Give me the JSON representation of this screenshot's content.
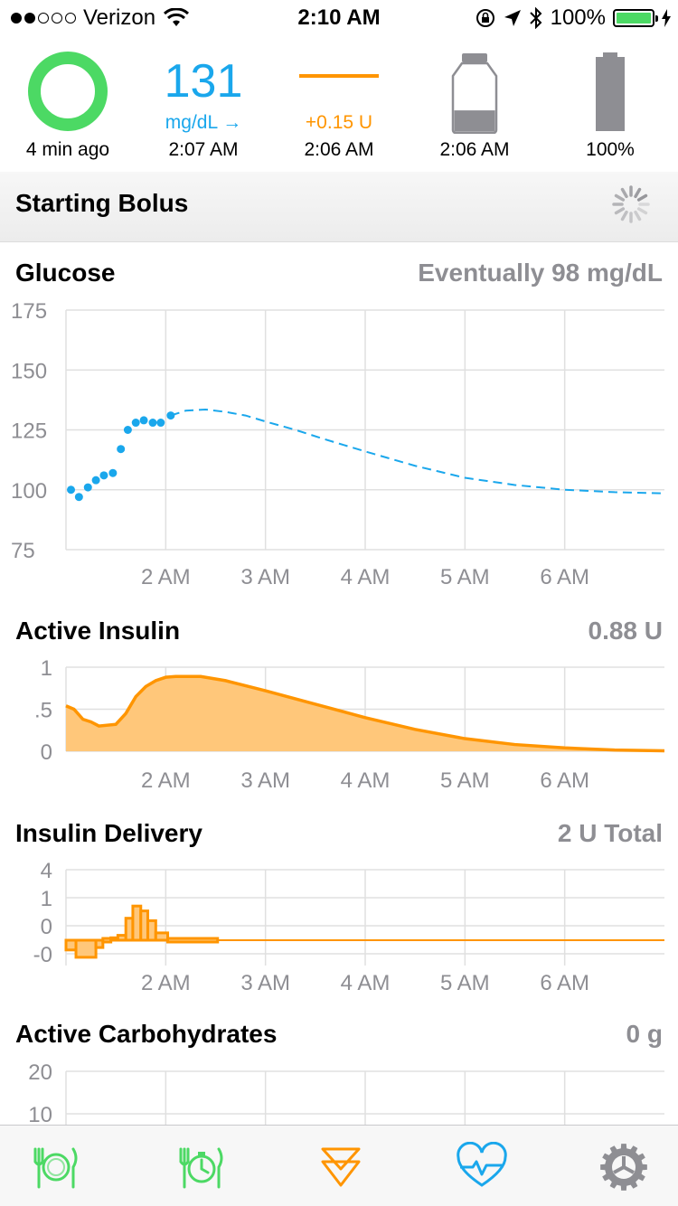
{
  "status_bar": {
    "carrier": "Verizon",
    "time": "2:10 AM",
    "battery_percent": "100%"
  },
  "hud": {
    "loop": {
      "age": "4 min ago"
    },
    "glucose": {
      "value": "131",
      "unit": "mg/dL →",
      "time": "2:07 AM"
    },
    "basal": {
      "rate": "+0.15 U",
      "time": "2:06 AM"
    },
    "reservoir": {
      "time": "2:06 AM",
      "level": 0.3
    },
    "pump_battery": {
      "percent": "100%",
      "level": 1.0
    }
  },
  "status": {
    "title": "Starting Bolus"
  },
  "glucose": {
    "title": "Glucose",
    "summary": "Eventually 98 mg/dL"
  },
  "active_insulin": {
    "title": "Active Insulin",
    "summary": "0.88 U"
  },
  "insulin_delivery": {
    "title": "Insulin Delivery",
    "summary": "2 U Total"
  },
  "active_carbs": {
    "title": "Active Carbohydrates",
    "summary": "0 g"
  },
  "x_ticks": [
    "2 AM",
    "3 AM",
    "4 AM",
    "5 AM",
    "6 AM"
  ],
  "colors": {
    "glucose": "#1aa7ec",
    "insulin": "#ff9500",
    "insulin_fill": "#ffc77a",
    "loop": "#4cd964",
    "axis_text": "#8e8e93",
    "grid": "#e0e0e0"
  },
  "tabs": [
    {
      "icon": "carb-entry-icon"
    },
    {
      "icon": "carb-timer-icon"
    },
    {
      "icon": "bolus-icon"
    },
    {
      "icon": "health-heart-icon"
    },
    {
      "icon": "settings-gear-icon"
    }
  ],
  "chart_data": [
    {
      "type": "scatter",
      "title": "Glucose",
      "x_start": "1:00 AM",
      "x_end": "7:00 AM",
      "ylim": [
        75,
        175
      ],
      "y_ticks": [
        "175",
        "150",
        "125",
        "100",
        "75"
      ],
      "series": [
        {
          "name": "observed",
          "x_hours": [
            1.05,
            1.13,
            1.22,
            1.3,
            1.38,
            1.47,
            1.55,
            1.62,
            1.7,
            1.78,
            1.87,
            1.95,
            2.05
          ],
          "y": [
            100,
            97,
            101,
            104,
            106,
            107,
            117,
            125,
            128,
            129,
            128,
            128,
            131
          ]
        },
        {
          "name": "predicted",
          "x_hours": [
            2.05,
            2.2,
            2.4,
            2.6,
            2.8,
            3.0,
            3.3,
            3.6,
            4.0,
            4.5,
            5.0,
            5.5,
            6.0,
            6.5,
            7.0
          ],
          "y": [
            131,
            133,
            133.5,
            132.5,
            131,
            128.5,
            125,
            121,
            116,
            110,
            105,
            102,
            100,
            99,
            98.5
          ]
        }
      ]
    },
    {
      "type": "area",
      "title": "Active Insulin",
      "ylim": [
        0,
        1
      ],
      "y_ticks": [
        "1",
        ".5",
        "0"
      ],
      "x_hours": [
        1.0,
        1.08,
        1.17,
        1.25,
        1.33,
        1.5,
        1.6,
        1.7,
        1.8,
        1.9,
        2.0,
        2.1,
        2.35,
        2.6,
        3.0,
        3.5,
        4.0,
        4.5,
        5.0,
        5.5,
        6.0,
        6.5,
        7.0
      ],
      "y": [
        0.54,
        0.5,
        0.38,
        0.35,
        0.3,
        0.32,
        0.45,
        0.65,
        0.77,
        0.84,
        0.88,
        0.89,
        0.89,
        0.84,
        0.72,
        0.56,
        0.4,
        0.26,
        0.15,
        0.08,
        0.04,
        0.015,
        0.005
      ]
    },
    {
      "type": "bar",
      "title": "Insulin Delivery",
      "ylim": [
        -0.6,
        4
      ],
      "y_ticks": [
        "4",
        "1",
        "0",
        "-0"
      ],
      "bars": [
        {
          "start": 1.0,
          "end": 1.1,
          "value": -0.4
        },
        {
          "start": 1.1,
          "end": 1.3,
          "value": -0.7
        },
        {
          "start": 1.3,
          "end": 1.37,
          "value": -0.3
        },
        {
          "start": 1.37,
          "end": 1.45,
          "value": 0.0
        },
        {
          "start": 1.45,
          "end": 1.52,
          "value": 0.1
        },
        {
          "start": 1.52,
          "end": 1.6,
          "value": 0.2
        },
        {
          "start": 1.6,
          "end": 1.67,
          "value": 0.9
        },
        {
          "start": 1.67,
          "end": 1.75,
          "value": 1.4
        },
        {
          "start": 1.75,
          "end": 1.82,
          "value": 1.2
        },
        {
          "start": 1.82,
          "end": 1.9,
          "value": 0.8
        },
        {
          "start": 1.9,
          "end": 2.02,
          "value": 0.3
        },
        {
          "start": 2.02,
          "end": 2.52,
          "value": 0.0
        }
      ]
    },
    {
      "type": "area",
      "title": "Active Carbohydrates",
      "y_ticks": [
        "20",
        "10"
      ],
      "y": []
    }
  ]
}
